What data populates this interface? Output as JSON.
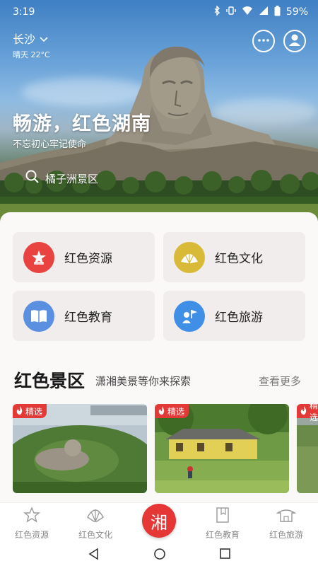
{
  "status": {
    "time": "3:19",
    "battery": "59%"
  },
  "header": {
    "city": "长沙",
    "weather": "晴天 22°C"
  },
  "hero": {
    "title": "畅游，红色湖南",
    "subtitle": "不忘初心牢记使命",
    "search_text": "橘子洲景区"
  },
  "categories": [
    {
      "label": "红色资源",
      "color": "#e84340",
      "icon": "flag-star-icon"
    },
    {
      "label": "红色文化",
      "color": "#d8b938",
      "icon": "fan-icon"
    },
    {
      "label": "红色教育",
      "color": "#5b8fe0",
      "icon": "book-icon"
    },
    {
      "label": "红色旅游",
      "color": "#3f8fe6",
      "icon": "guide-flag-icon"
    }
  ],
  "section": {
    "title": "红色景区",
    "subtitle": "潇湘美景等你来探索",
    "more": "查看更多"
  },
  "scenic_cards": [
    {
      "badge": "精选"
    },
    {
      "badge": "精选"
    },
    {
      "badge": "精选"
    }
  ],
  "bottom_nav": {
    "items": [
      {
        "label": "红色资源"
      },
      {
        "label": "红色文化"
      },
      {
        "label": "红色教育"
      },
      {
        "label": "红色旅游"
      }
    ],
    "center": "湘"
  },
  "colors": {
    "accent": "#e53735"
  }
}
